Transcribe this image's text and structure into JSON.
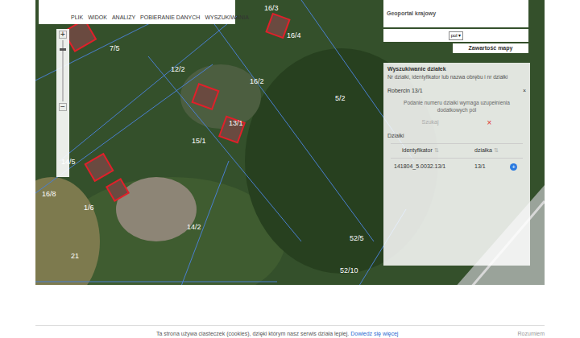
{
  "toolbar": {
    "menu": [
      "PLIK",
      "WIDOK",
      "ANALIZY",
      "POBIERANIE DANYCH",
      "WYSZUKIWANIA"
    ]
  },
  "zoom": {
    "plus": "+",
    "minus": "−",
    "level": 0.87
  },
  "portal": {
    "title": "Geoportal krajowy",
    "language": "pol",
    "contents_button": "Zawartość mapy"
  },
  "map": {
    "labels": [
      "16/3",
      "16/4",
      "7/5",
      "12/2",
      "16/2",
      "5/2",
      "13/1",
      "15/1",
      "14/5",
      "16/8",
      "1/6",
      "14/2",
      "21",
      "52/5",
      "52/10"
    ]
  },
  "search_panel": {
    "title": "Wyszukiwanie działek",
    "hint": "Nr działki, identyfikator lub nazwa obrębu i nr działki",
    "query": "Robercin 13/1",
    "clear": "×",
    "warning": "Podanie numeru działki wymaga uzupełnienia dodatkowych pól",
    "search_button": {
      "label": "Szukaj",
      "disabled": true
    },
    "cancel": "×",
    "results_title": "Działki",
    "columns": [
      {
        "label": "identyfikator",
        "sort": "⇅"
      },
      {
        "label": "działka",
        "sort": "⇅"
      }
    ],
    "rows": [
      {
        "identyfikator": "141804_5.0032.13/1",
        "dzialka": "13/1",
        "action": "+"
      }
    ]
  },
  "cookie_bar": {
    "text": "Ta strona używa ciasteczek (cookies), dzięki którym nasz serwis działa lepiej.",
    "link": "Dowiedz się więcej",
    "button": "Rozumiem"
  }
}
